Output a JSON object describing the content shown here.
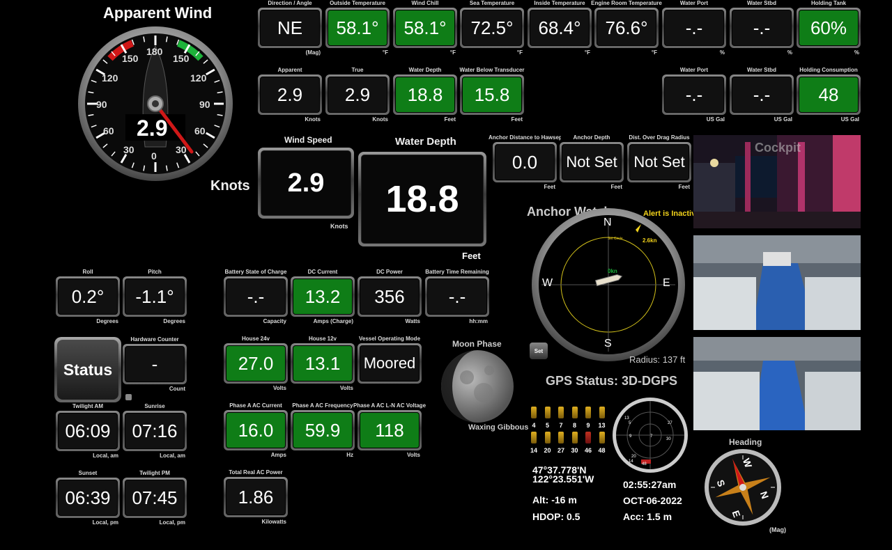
{
  "apparent_wind": {
    "title": "Apparent Wind",
    "value": "2.9",
    "scale_top": [
      "150",
      "180",
      "150"
    ],
    "scale_left": [
      "120",
      "90",
      "60",
      "30"
    ],
    "scale_right": [
      "120",
      "90",
      "60",
      "30"
    ],
    "scale_bottom": "0"
  },
  "row1": [
    {
      "label": "Direction / Angle",
      "value": "NE",
      "unit": "(Mag)",
      "green": false
    },
    {
      "label": "Outside Temperature",
      "value": "58.1°",
      "unit": "°F",
      "green": true
    },
    {
      "label": "Wind Chill",
      "value": "58.1°",
      "unit": "°F",
      "green": true
    },
    {
      "label": "Sea Temperature",
      "value": "72.5°",
      "unit": "°F",
      "green": false
    },
    {
      "label": "Inside Temperature",
      "value": "68.4°",
      "unit": "°F",
      "green": false
    },
    {
      "label": "Engine Room Temperature",
      "value": "76.6°",
      "unit": "°F",
      "green": false
    },
    {
      "label": "Water Port",
      "value": "-.-",
      "unit": "%",
      "green": false
    },
    {
      "label": "Water Stbd",
      "value": "-.-",
      "unit": "%",
      "green": false
    },
    {
      "label": "Holding Tank",
      "value": "60%",
      "unit": "%",
      "green": true
    }
  ],
  "row2": [
    {
      "label": "Apparent",
      "value": "2.9",
      "unit": "Knots",
      "green": false
    },
    {
      "label": "True",
      "value": "2.9",
      "unit": "Knots",
      "green": false
    },
    {
      "label": "Water Depth",
      "value": "18.8",
      "unit": "Feet",
      "green": true
    },
    {
      "label": "Water Below Transducer",
      "value": "15.8",
      "unit": "Feet",
      "green": true
    }
  ],
  "row2b": [
    {
      "label": "Water Port",
      "value": "-.-",
      "unit": "US Gal",
      "green": false
    },
    {
      "label": "Water Stbd",
      "value": "-.-",
      "unit": "US Gal",
      "green": false
    },
    {
      "label": "Holding Consumption",
      "value": "48",
      "unit": "US Gal",
      "green": true
    }
  ],
  "wind_speed": {
    "label": "Wind Speed",
    "value": "2.9",
    "unit": "Knots",
    "side": "Knots"
  },
  "water_depth_big": {
    "label": "Water Depth",
    "value": "18.8",
    "unit": "Feet"
  },
  "anchor_tiles": [
    {
      "label": "Anchor Distance to Hawsepipe",
      "value": "0.0",
      "unit": "Feet",
      "green": false
    },
    {
      "label": "Anchor Depth",
      "value": "Not Set",
      "unit": "Feet",
      "green": false
    },
    {
      "label": "Dist. Over Drag Radius",
      "value": "Not Set",
      "unit": "Feet",
      "green": false
    }
  ],
  "anchor_watch": {
    "title": "Anchor Watch",
    "alert": "Alert is Inactive",
    "n": "N",
    "s": "S",
    "e": "E",
    "w": "W",
    "set_circle": "Set Circle",
    "speed_near": "0kn",
    "speed_far": "2.6kn",
    "radius": "Radius: 137 ft",
    "set_button": "Set"
  },
  "cameras": {
    "cockpit": "Cockpit"
  },
  "attitude": [
    {
      "label": "Roll",
      "value": "0.2°",
      "unit": "Degrees",
      "green": false
    },
    {
      "label": "Pitch",
      "value": "-1.1°",
      "unit": "Degrees",
      "green": false
    }
  ],
  "status_button": "Status",
  "hardware_counter": {
    "label": "Hardware Counter",
    "value": "-",
    "unit": "Count"
  },
  "times": [
    {
      "label": "Twilight AM",
      "value": "06:09",
      "unit": "Local, am",
      "green": false
    },
    {
      "label": "Sunrise",
      "value": "07:16",
      "unit": "Local, am",
      "green": false
    },
    {
      "label": "Sunset",
      "value": "06:39",
      "unit": "Local, pm",
      "green": false
    },
    {
      "label": "Twilight PM",
      "value": "07:45",
      "unit": "Local, pm",
      "green": false
    }
  ],
  "power": [
    {
      "label": "Battery State of Charge",
      "value": "-.-",
      "unit": "Capacity",
      "green": false
    },
    {
      "label": "DC Current",
      "value": "13.2",
      "unit": "Amps (Charge)",
      "green": true
    },
    {
      "label": "DC Power",
      "value": "356",
      "unit": "Watts",
      "green": false
    },
    {
      "label": "Battery Time Remaining",
      "value": "-.-",
      "unit": "hh:mm",
      "green": false
    },
    {
      "label": "House 24v",
      "value": "27.0",
      "unit": "Volts",
      "green": true
    },
    {
      "label": "House 12v",
      "value": "13.1",
      "unit": "Volts",
      "green": true
    },
    {
      "label": "Vessel Operating Mode",
      "value": "Moored",
      "unit": "",
      "green": false
    },
    {
      "label": "Phase A AC Current",
      "value": "16.0",
      "unit": "Amps",
      "green": true
    },
    {
      "label": "Phase A AC Frequency",
      "value": "59.9",
      "unit": "Hz",
      "green": true
    },
    {
      "label": "Phase A AC L-N AC Voltage",
      "value": "118",
      "unit": "Volts",
      "green": true
    },
    {
      "label": "Total Real AC Power",
      "value": "1.86",
      "unit": "Kilowatts",
      "green": false
    }
  ],
  "moon": {
    "title": "Moon Phase",
    "phase": "Waxing Gibbous",
    "illumination": 0.8
  },
  "gps": {
    "status": "GPS Status: 3D-DGPS",
    "sats_row1": [
      "4",
      "5",
      "7",
      "8",
      "9",
      "13"
    ],
    "sats_row2": [
      "14",
      "20",
      "27",
      "30",
      "46",
      "48"
    ],
    "lat": "47°37.778'N",
    "lon": "122°23.551'W",
    "alt": "Alt: -16 m",
    "hdop": "HDOP:  0.5",
    "time": "02:55:27am",
    "date": "OCT-06-2022",
    "acc": "Acc:   1.5 m",
    "sky_labels": [
      "13",
      "5",
      "27",
      "7",
      "9",
      "30",
      "20",
      "14",
      "48"
    ]
  },
  "heading": {
    "title": "Heading",
    "unit": "(Mag)",
    "s": "S",
    "w": "W",
    "n": "N",
    "e": "E"
  },
  "colors": {
    "green": "#0f7d17",
    "red": "#d01818",
    "accent_green": "#1db33a",
    "yellow": "#f2d21b"
  }
}
